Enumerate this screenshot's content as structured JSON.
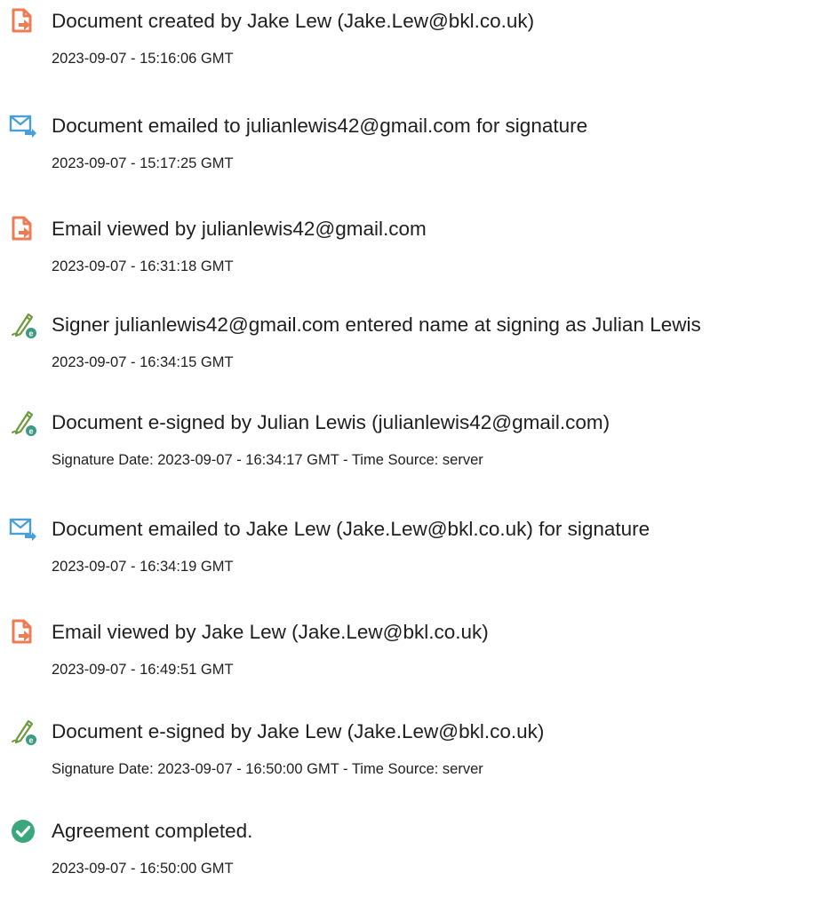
{
  "audit_events": [
    {
      "icon": "document-created-icon",
      "description": "Document created by Jake Lew (Jake.Lew@bkl.co.uk)",
      "timestamp": "2023-09-07 - 15:16:06 GMT"
    },
    {
      "icon": "email-sent-icon",
      "description": "Document emailed to julianlewis42@gmail.com for signature",
      "timestamp": "2023-09-07 - 15:17:25 GMT"
    },
    {
      "icon": "document-viewed-icon",
      "description": "Email viewed by julianlewis42@gmail.com",
      "timestamp": "2023-09-07 - 16:31:18 GMT"
    },
    {
      "icon": "e-sign-icon",
      "description": "Signer julianlewis42@gmail.com entered name at signing as Julian Lewis",
      "timestamp": "2023-09-07 - 16:34:15 GMT"
    },
    {
      "icon": "e-sign-icon",
      "description": "Document e-signed by Julian Lewis (julianlewis42@gmail.com)",
      "timestamp": "Signature Date: 2023-09-07 - 16:34:17 GMT - Time Source: server"
    },
    {
      "icon": "email-sent-icon",
      "description": "Document emailed to Jake Lew (Jake.Lew@bkl.co.uk) for signature",
      "timestamp": "2023-09-07 - 16:34:19 GMT"
    },
    {
      "icon": "document-viewed-icon",
      "description": "Email viewed by Jake Lew (Jake.Lew@bkl.co.uk)",
      "timestamp": "2023-09-07 - 16:49:51 GMT"
    },
    {
      "icon": "e-sign-icon",
      "description": "Document e-signed by Jake Lew (Jake.Lew@bkl.co.uk)",
      "timestamp": "Signature Date: 2023-09-07 - 16:50:00 GMT - Time Source: server"
    },
    {
      "icon": "completed-check-icon",
      "description": "Agreement completed.",
      "timestamp": "2023-09-07 - 16:50:00 GMT"
    }
  ],
  "colors": {
    "document_icon": "#ee7b53",
    "email_icon": "#4a9fd8",
    "sign_pen": "#6f9a3c",
    "sign_badge": "#3d9a84",
    "completed_check": "#3aa87c"
  }
}
